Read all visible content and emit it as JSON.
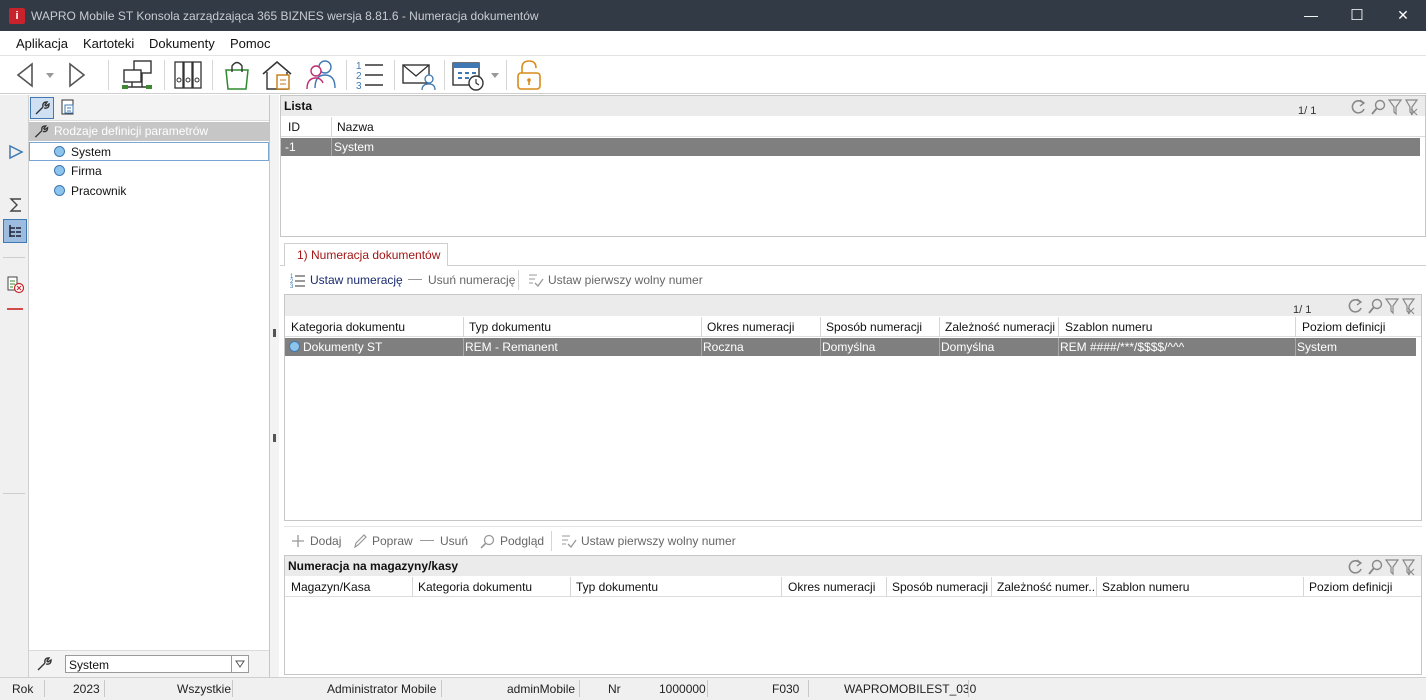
{
  "window": {
    "title": "WAPRO Mobile ST Konsola zarządzająca 365 BIZNES wersja 8.81.6 - Numeracja dokumentów",
    "app_icon_letter": "i",
    "minimize_glyph": "—",
    "maximize_glyph": "☐",
    "close_glyph": "✕"
  },
  "menu": [
    "Aplikacja",
    "Kartoteki",
    "Dokumenty",
    "Pomoc"
  ],
  "toolbar_icons": [
    "back-arrow-icon",
    "dropdown-arrow-icon",
    "forward-arrow-icon",
    "network-computers-icon",
    "binders-icon",
    "shopping-bag-icon",
    "house-calculator-icon",
    "users-icon",
    "numbered-list-icon",
    "mail-user-icon",
    "calendar-clock-icon",
    "dropdown-arrow-icon",
    "padlock-icon"
  ],
  "left": {
    "root_label": "Rodzaje definicji parametrów",
    "tree": [
      "System",
      "Firma",
      "Pracownik"
    ],
    "selected_index": 0,
    "footer_select_value": "System",
    "strip_icons": [
      "wrench-icon",
      "play-arrow-icon",
      "sigma-icon",
      "tree-view-icon",
      "checklist-cancel-icon",
      "minus-icon"
    ],
    "tab_icons": [
      "wrench-icon",
      "calculator-doc-icon"
    ]
  },
  "lista": {
    "title": "Lista",
    "page": "1/ 1",
    "columns": [
      "ID",
      "Nazwa"
    ],
    "rows": [
      [
        "-1",
        "System"
      ]
    ]
  },
  "tab": {
    "label": "1) Numeracja dokumentów"
  },
  "numeracja": {
    "actions": {
      "set": "Ustaw numerację",
      "remove": "Usuń numerację",
      "first_free": "Ustaw pierwszy wolny numer"
    },
    "page": "1/ 1",
    "columns": [
      "Kategoria dokumentu",
      "Typ dokumentu",
      "Okres numeracji",
      "Sposób numeracji",
      "Zależność numeracji",
      "Szablon numeru",
      "Poziom definicji"
    ],
    "rows": [
      [
        "Dokumenty ST",
        "REM - Remanent",
        "Roczna",
        "Domyślna",
        "Domyślna",
        "REM ####/***/$$$$/^^^",
        "System"
      ]
    ]
  },
  "magazyny": {
    "actions": {
      "add": "Dodaj",
      "edit": "Popraw",
      "remove": "Usuń",
      "preview": "Podgląd",
      "first_free": "Ustaw pierwszy wolny numer"
    },
    "title": "Numeracja na magazyny/kasy",
    "columns": [
      "Magazyn/Kasa",
      "Kategoria dokumentu",
      "Typ dokumentu",
      "Okres numeracji",
      "Sposób numeracji",
      "Zależność numer...",
      "Szablon numeru",
      "Poziom definicji"
    ],
    "rows": []
  },
  "status": {
    "rok_label": "Rok",
    "rok": "2023",
    "filter": "Wszystkie",
    "user_full": "Administrator Mobile",
    "user": "adminMobile",
    "nr_label": "Nr",
    "nr": "1000000",
    "code": "F030",
    "db": "WAPROMOBILEST_030"
  },
  "colors": {
    "titlebar_bg": "#323a46",
    "selected_row_bg": "#7f7f7f",
    "tab_text": "#a31515",
    "accent_blue": "#3f78b3"
  }
}
